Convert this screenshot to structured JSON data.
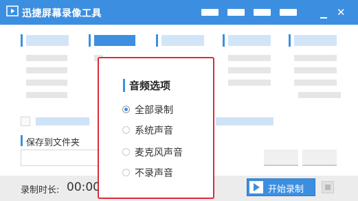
{
  "titlebar": {
    "app_icon": "record-camera-icon",
    "title": "迅捷屏幕录像工具",
    "close_glyph": "✕"
  },
  "settings": {
    "folder_label": "保存到文件夹"
  },
  "bottom": {
    "duration_label": "录制时长:",
    "duration_value": "00:00",
    "start_icon": "play-icon",
    "start_label": "开始录制",
    "stop_icon": "stop-icon"
  },
  "audio_popup": {
    "title": "音频选项",
    "options": [
      {
        "label": "全部录制",
        "selected": true
      },
      {
        "label": "系统声音",
        "selected": false
      },
      {
        "label": "麦克风声音",
        "selected": false
      },
      {
        "label": "不录声音",
        "selected": false
      }
    ]
  },
  "colors": {
    "accent": "#3c8fe0",
    "popup_border": "#d72b3a"
  }
}
